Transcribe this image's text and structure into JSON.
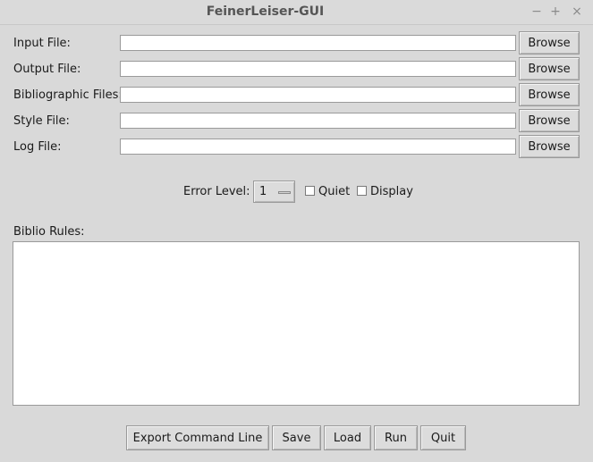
{
  "window": {
    "title": "FeinerLeiser-GUI",
    "minimize_glyph": "−",
    "maximize_glyph": "+",
    "close_glyph": "×"
  },
  "fields": [
    {
      "label": "Input File:",
      "value": "",
      "browse": "Browse"
    },
    {
      "label": "Output File:",
      "value": "",
      "browse": "Browse"
    },
    {
      "label": "Bibliographic Files:",
      "value": "",
      "browse": "Browse"
    },
    {
      "label": "Style File:",
      "value": "",
      "browse": "Browse"
    },
    {
      "label": "Log File:",
      "value": "",
      "browse": "Browse"
    }
  ],
  "options": {
    "error_level_label": "Error Level:",
    "error_level_value": "1",
    "quiet_label": "Quiet",
    "quiet_checked": false,
    "display_label": "Display",
    "display_checked": false
  },
  "biblio": {
    "label": "Biblio Rules:",
    "value": ""
  },
  "actions": {
    "export": "Export Command Line",
    "save": "Save",
    "load": "Load",
    "run": "Run",
    "quit": "Quit"
  }
}
